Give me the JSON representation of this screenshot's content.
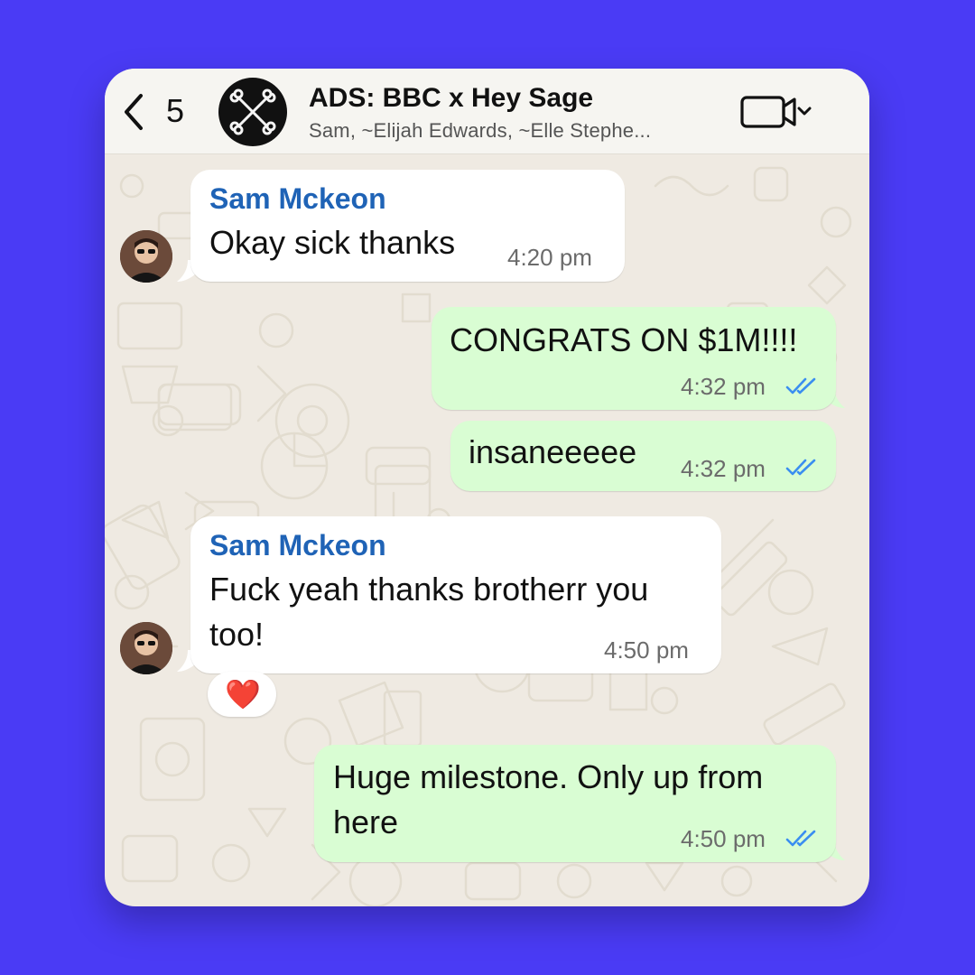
{
  "header": {
    "back_count": "5",
    "group_title": "ADS: BBC x Hey Sage",
    "group_members": "Sam, ~Elijah Edwards, ~Elle Stephe..."
  },
  "messages": [
    {
      "direction": "incoming",
      "sender": "Sam Mckeon",
      "text": "Okay sick thanks",
      "time": "4:20 pm"
    },
    {
      "direction": "outgoing",
      "text": "CONGRATS ON $1M!!!!",
      "time": "4:32 pm",
      "status": "read"
    },
    {
      "direction": "outgoing",
      "text": "insaneeeee",
      "time": "4:32 pm",
      "status": "read"
    },
    {
      "direction": "incoming",
      "sender": "Sam Mckeon",
      "text_lines": [
        "Fuck yeah thanks brotherr you",
        "too!"
      ],
      "time": "4:50 pm",
      "reaction": "❤️"
    },
    {
      "direction": "outgoing",
      "text_lines": [
        "Huge milestone. Only up from",
        "here"
      ],
      "time": "4:50 pm",
      "status": "read"
    }
  ],
  "colors": {
    "page_background": "#4a3bf5",
    "chat_background": "#efeae2",
    "incoming_bubble": "#ffffff",
    "outgoing_bubble": "#d9fdd3",
    "sender_name": "#1f63b6",
    "read_ticks": "#3a8ef0"
  },
  "icons": [
    "back-chevron-icon",
    "crossed-bones-icon",
    "video-call-icon",
    "chevron-down-icon",
    "double-check-icon",
    "heart-icon"
  ]
}
